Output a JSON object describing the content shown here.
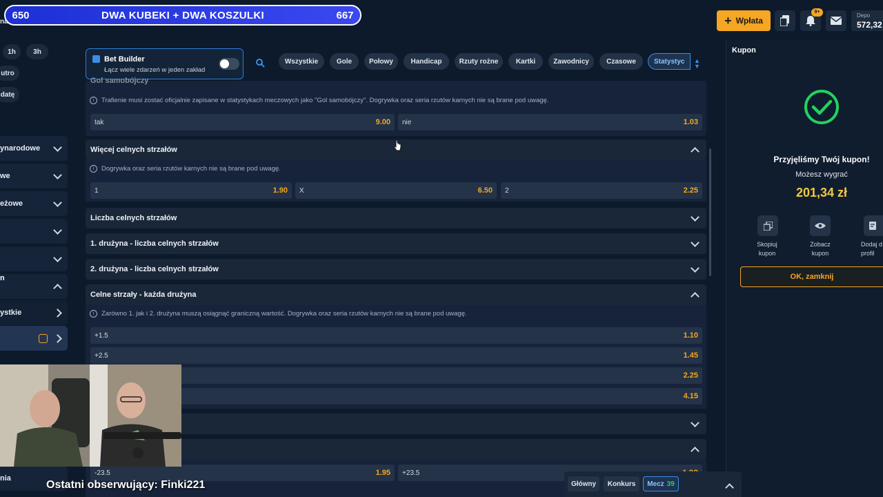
{
  "banner": {
    "left_num": "650",
    "title": "DWA KUBEKI + DWA KOSZULKI",
    "right_num": "667"
  },
  "sidebar": {
    "fragment_top": "na",
    "chips": [
      "1h",
      "3h"
    ],
    "chip_utro": "utro",
    "chip_date": "datę",
    "rows": [
      "ynarodowe",
      "we",
      "eżowe",
      "",
      "",
      "",
      "ystkie",
      ""
    ],
    "row_bottom": "nia"
  },
  "header": {
    "deposit_button": "Wpłata",
    "badge": "9+",
    "balance_label": "Depo",
    "balance_value": "572,32"
  },
  "filter": {
    "bet_builder_title": "Bet Builder",
    "bet_builder_sub": "Łącz wiele zdarzeń w jeden zakład",
    "pills": [
      "Wszystkie",
      "Gole",
      "Połowy",
      "Handicap",
      "Rzuty rożne",
      "Kartki",
      "Zawodnicy",
      "Czasowe",
      "Statystyc"
    ]
  },
  "markets": {
    "m0_title": "Gol samobójczy",
    "m0_info": "Trafienie musi zostać oficjalnie zapisane w statystykach meczowych jako \"Gol samobójczy\". Dogrywka oraz seria rzutów karnych nie są brane pod uwagę.",
    "m0_odds": [
      {
        "label": "tak",
        "value": "9.00"
      },
      {
        "label": "nie",
        "value": "1.03"
      }
    ],
    "m1_title": "Więcej celnych strzałów",
    "m1_info": "Dogrywka oraz seria rzutów karnych nie są brane pod uwagę.",
    "m1_odds": [
      {
        "label": "1",
        "value": "1.90"
      },
      {
        "label": "X",
        "value": "6.50"
      },
      {
        "label": "2",
        "value": "2.25"
      }
    ],
    "m2_title": "Liczba celnych strzałów",
    "m3_title": "1. drużyna - liczba celnych strzałów",
    "m4_title": "2. drużyna - liczba celnych strzałów",
    "m5_title": "Celne strzały - każda drużyna",
    "m5_info": "Zarówno 1. jak i 2. drużyna muszą osiągnąć graniczną wartość. Dogrywka oraz seria rzutów karnych nie są brane pod uwagę.",
    "m5_odds": [
      {
        "label": "+1.5",
        "value": "1.10"
      },
      {
        "label": "+2.5",
        "value": "1.45"
      },
      {
        "label": "",
        "value": "2.25"
      },
      {
        "label": "",
        "value": "4.15"
      }
    ],
    "m7_odds": [
      {
        "label": "-23.5",
        "value": "1.95"
      },
      {
        "label": "+23.5",
        "value": "1.??"
      }
    ]
  },
  "kupon": {
    "title": "Kupon",
    "accepted": "Przyjęliśmy Twój kupon!",
    "can_win": "Możesz wygrać",
    "amount": "201,34 zł",
    "act1_l1": "Skopiuj",
    "act1_l2": "kupon",
    "act2_l1": "Zobacz",
    "act2_l2": "kupon",
    "act3_l1": "Dodaj d",
    "act3_l2": "profil",
    "ok_button": "OK, zamknij",
    "accent": "#f5c842",
    "success": "#23d160"
  },
  "bottom_tabs": {
    "glowny": "Główny",
    "konkurs": "Konkurs",
    "mecz": "Mecz",
    "mecz_count": "39"
  },
  "overlay": {
    "follower_text": "Ostatni obserwujący: Finki221"
  }
}
